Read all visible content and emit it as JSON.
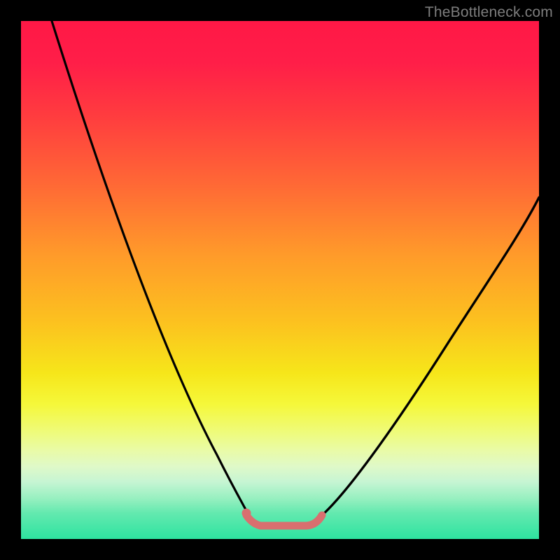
{
  "watermark": {
    "text": "TheBottleneck.com"
  },
  "chart_data": {
    "type": "line",
    "title": "",
    "xlabel": "",
    "ylabel": "",
    "xlim": [
      0,
      100
    ],
    "ylim": [
      0,
      100
    ],
    "series": [
      {
        "name": "left-curve",
        "x": [
          6,
          10,
          14,
          18,
          22,
          26,
          30,
          34,
          38,
          40,
          42,
          44
        ],
        "values": [
          100,
          87,
          74,
          62,
          51,
          41,
          31,
          22,
          14,
          9,
          5,
          3
        ]
      },
      {
        "name": "right-curve",
        "x": [
          58,
          62,
          66,
          70,
          74,
          78,
          82,
          86,
          90,
          94,
          98,
          100
        ],
        "values": [
          3,
          5,
          8,
          13,
          18,
          24,
          31,
          39,
          47,
          55,
          63,
          67
        ]
      },
      {
        "name": "valley-marker",
        "x": [
          44,
          45,
          47,
          50,
          53,
          56,
          58
        ],
        "values": [
          3,
          2.2,
          2,
          2,
          2,
          2.2,
          3
        ]
      }
    ],
    "valley_dot": {
      "x": 44,
      "y": 4
    },
    "colors": {
      "curve": "#000000",
      "valley": "#d96f6f",
      "gradient_top": "#ff1846",
      "gradient_mid": "#f6e61a",
      "gradient_bottom": "#2ee3a0",
      "frame": "#000000"
    }
  }
}
